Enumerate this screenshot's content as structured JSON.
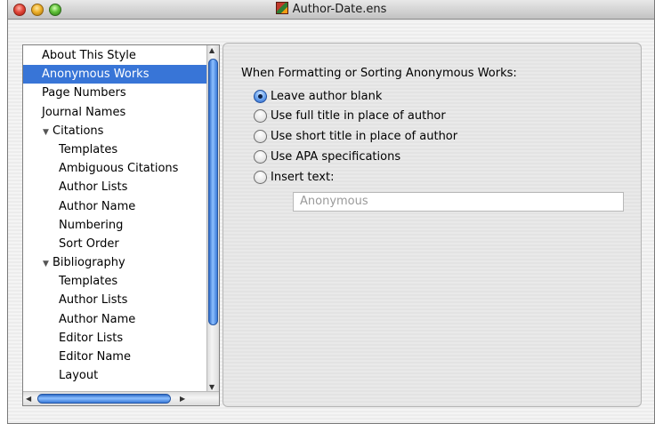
{
  "window": {
    "title": "Author-Date.ens",
    "title_icon": "document-style-icon"
  },
  "sidebar": {
    "items": [
      {
        "label": "About This Style",
        "level": 0,
        "selected": false
      },
      {
        "label": "Anonymous Works",
        "level": 0,
        "selected": true
      },
      {
        "label": "Page Numbers",
        "level": 0,
        "selected": false
      },
      {
        "label": "Journal Names",
        "level": 0,
        "selected": false
      },
      {
        "label": "Citations",
        "level": 0,
        "group": true,
        "expanded": true
      },
      {
        "label": "Templates",
        "level": 1
      },
      {
        "label": "Ambiguous Citations",
        "level": 1
      },
      {
        "label": "Author Lists",
        "level": 1
      },
      {
        "label": "Author Name",
        "level": 1
      },
      {
        "label": "Numbering",
        "level": 1
      },
      {
        "label": "Sort Order",
        "level": 1
      },
      {
        "label": "Bibliography",
        "level": 0,
        "group": true,
        "expanded": true
      },
      {
        "label": "Templates",
        "level": 1
      },
      {
        "label": "Author Lists",
        "level": 1
      },
      {
        "label": "Author Name",
        "level": 1
      },
      {
        "label": "Editor Lists",
        "level": 1
      },
      {
        "label": "Editor Name",
        "level": 1
      },
      {
        "label": "Layout",
        "level": 1
      }
    ]
  },
  "panel": {
    "heading": "When Formatting or Sorting Anonymous Works:",
    "options": [
      {
        "label": "Leave author blank",
        "checked": true
      },
      {
        "label": "Use full title in place of author",
        "checked": false
      },
      {
        "label": "Use short title in place of author",
        "checked": false
      },
      {
        "label": "Use APA specifications",
        "checked": false
      },
      {
        "label": "Insert text:",
        "checked": false
      }
    ],
    "insert_text_value": "Anonymous"
  },
  "colors": {
    "selection": "#3875d7",
    "scroll_thumb": "#3a7ad8"
  }
}
